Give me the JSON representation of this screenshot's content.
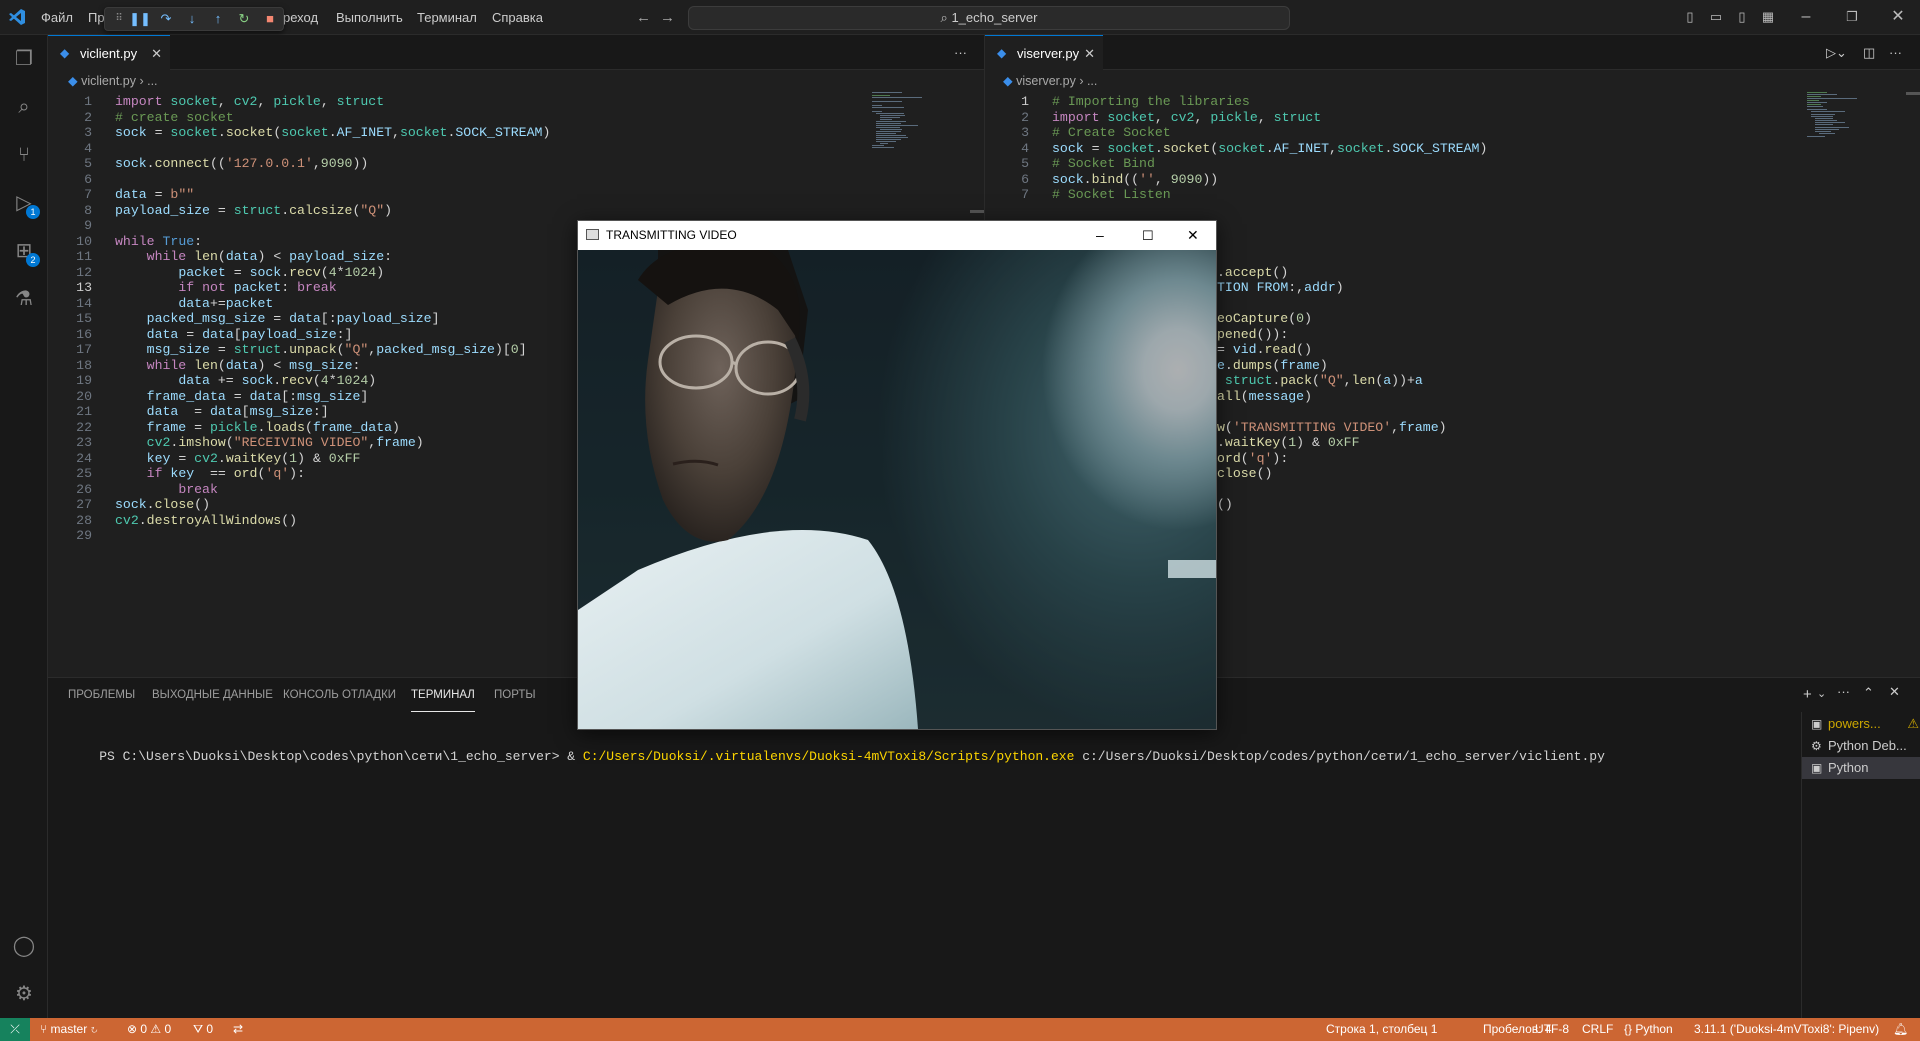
{
  "menu": [
    "Файл",
    "Пр",
    "реход",
    "Выполнить",
    "Терминал",
    "Справка"
  ],
  "search": {
    "text": "1_echo_server"
  },
  "activity_badges": {
    "debug": "1",
    "extensions": "2"
  },
  "left_editor": {
    "tab": "viclient.py",
    "breadcrumb": [
      "viclient.py",
      "..."
    ],
    "line_numbers": [
      "1",
      "2",
      "3",
      "4",
      "5",
      "6",
      "7",
      "8",
      "9",
      "10",
      "11",
      "12",
      "13",
      "14",
      "15",
      "16",
      "17",
      "18",
      "19",
      "20",
      "21",
      "22",
      "23",
      "24",
      "25",
      "26",
      "27",
      "28",
      "29"
    ],
    "lines": [
      "import socket, cv2, pickle, struct",
      "# create socket",
      "sock = socket.socket(socket.AF_INET,socket.SOCK_STREAM)",
      "",
      "sock.connect(('127.0.0.1',9090))",
      "",
      "data = b\"\"",
      "payload_size = struct.calcsize(\"Q\")",
      "",
      "while True:",
      "    while len(data) < payload_size:",
      "        packet = sock.recv(4*1024)",
      "        if not packet: break",
      "        data+=packet",
      "    packed_msg_size = data[:payload_size]",
      "    data = data[payload_size:]",
      "    msg_size = struct.unpack(\"Q\",packed_msg_size)[0]",
      "    while len(data) < msg_size:",
      "        data += sock.recv(4*1024)",
      "    frame_data = data[:msg_size]",
      "    data  = data[msg_size:]",
      "    frame = pickle.loads(frame_data)",
      "    cv2.imshow(\"RECEIVING VIDEO\",frame)",
      "    key = cv2.waitKey(1) & 0xFF",
      "    if key  == ord('q'):",
      "        break",
      "sock.close()",
      "cv2.destroyAllWindows()",
      ""
    ]
  },
  "right_editor": {
    "tab": "viserver.py",
    "breadcrumb": [
      "viserver.py",
      "..."
    ],
    "line_numbers": [
      "1",
      "2",
      "3",
      "4",
      "5",
      "6",
      "7"
    ],
    "lines": [
      "# Importing the libraries",
      "import socket, cv2, pickle, struct",
      "# Create Socket",
      "sock = socket.socket(socket.AF_INET,socket.SOCK_STREAM)",
      "# Socket Bind",
      "sock.bind(('', 9090))",
      "# Socket Listen"
    ],
    "visible_fragments": [
      ".accept()",
      "TION FROM:',addr)",
      "",
      "eoCapture(0)",
      "pened()):",
      "= vid.read()",
      "e.dumps(frame)",
      " struct.pack(\"Q\",len(a))+a",
      "all(message)",
      "",
      "w('TRANSMITTING VIDEO',frame)",
      ".waitKey(1) & 0xFF",
      "ord('q'):",
      "close()",
      "",
      "()"
    ]
  },
  "panel": {
    "tabs": [
      "ПРОБЛЕМЫ",
      "ВЫХОДНЫЕ ДАННЫЕ",
      "КОНСОЛЬ ОТЛАДКИ",
      "ТЕРМИНАЛ",
      "ПОРТЫ"
    ],
    "active_tab": "ТЕРМИНАЛ",
    "terminal_prompt": "PS C:\\Users\\Duoksi\\Desktop\\codes\\python\\сети\\1_echo_server> ",
    "terminal_amp": "& ",
    "terminal_exe": "C:/Users/Duoksi/.virtualenvs/Duoksi-4mVToxi8/Scripts/python.exe",
    "terminal_arg": " c:/Users/Duoksi/Desktop/codes/python/сети/1_echo_server/viclient.py",
    "terminals": [
      "powers...",
      "Python Deb...",
      "Python"
    ]
  },
  "video_window": {
    "title": "TRANSMITTING VIDEO"
  },
  "status": {
    "branch": "master",
    "errors": "0",
    "warnings": "0",
    "ports": "0",
    "position": "Строка 1, столбец 1",
    "spaces": "Пробелов: 4",
    "encoding": "UTF-8",
    "eol": "CRLF",
    "language": "Python",
    "interpreter": "3.11.1 ('Duoksi-4mVToxi8': Pipenv)"
  },
  "colors": {
    "accent": "#0078d4",
    "statusbar": "#cc6633",
    "remote": "#16825d"
  }
}
